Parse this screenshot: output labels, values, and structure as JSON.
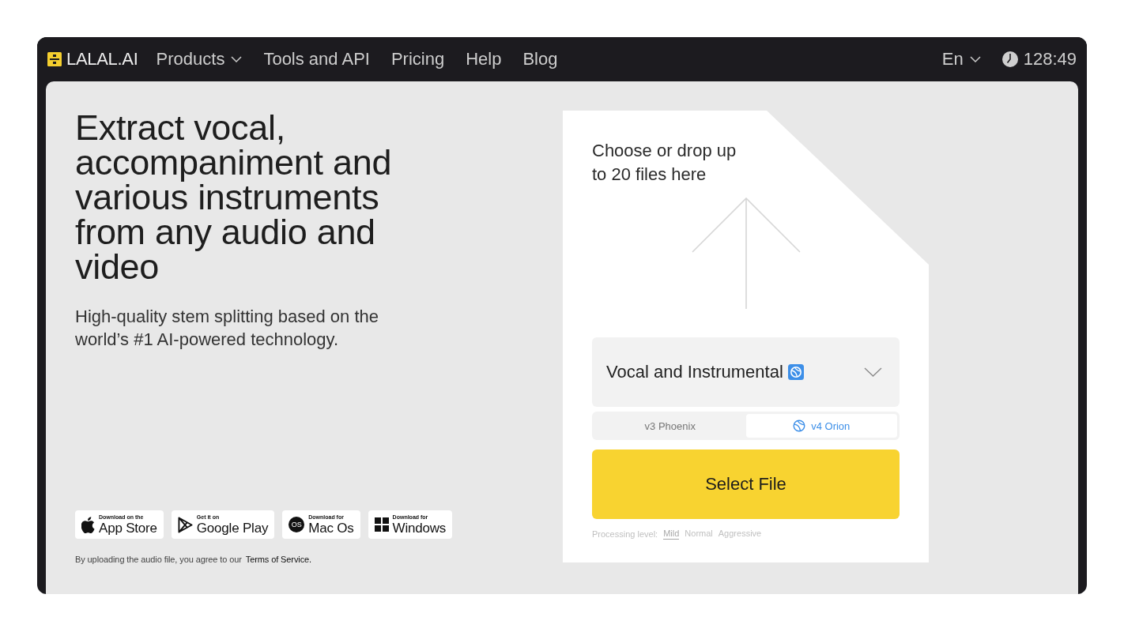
{
  "nav": {
    "logo": "LALAL.AI",
    "items": [
      {
        "label": "Products",
        "has_menu": true
      },
      {
        "label": "Tools and API",
        "has_menu": false
      },
      {
        "label": "Pricing",
        "has_menu": false
      },
      {
        "label": "Help",
        "has_menu": false
      },
      {
        "label": "Blog",
        "has_menu": false
      }
    ],
    "language": "En",
    "timer": "128:49"
  },
  "hero": {
    "title": "Extract vocal, accompaniment and various instruments from any audio and video",
    "subtitle": "High-quality stem splitting based on the world’s #1 AI-powered technology."
  },
  "downloads": [
    {
      "kind": "apple",
      "caption": "Download on the",
      "label": "App Store"
    },
    {
      "kind": "google-play",
      "caption": "Get it on",
      "label": "Google Play"
    },
    {
      "kind": "macos",
      "icon_text": "OS",
      "caption": "Download for",
      "label": "Mac Os"
    },
    {
      "kind": "windows",
      "caption": "Download for",
      "label": "Windows"
    }
  ],
  "terms": {
    "text": "By uploading the audio file, you agree to our",
    "link": "Terms of Service."
  },
  "upload": {
    "prompt": "Choose or drop up to 20 files here",
    "stem_select": {
      "value": "Vocal and Instrumental"
    },
    "models": [
      {
        "label": "v3 Phoenix",
        "has_icon": false,
        "selected": false
      },
      {
        "label": "v4 Orion",
        "has_icon": true,
        "selected": true
      }
    ],
    "button": "Select File",
    "processing": {
      "label": "Processing level:",
      "levels": [
        {
          "label": "Mild",
          "selected": true
        },
        {
          "label": "Normal",
          "selected": false
        },
        {
          "label": "Aggressive",
          "selected": false
        }
      ]
    }
  }
}
